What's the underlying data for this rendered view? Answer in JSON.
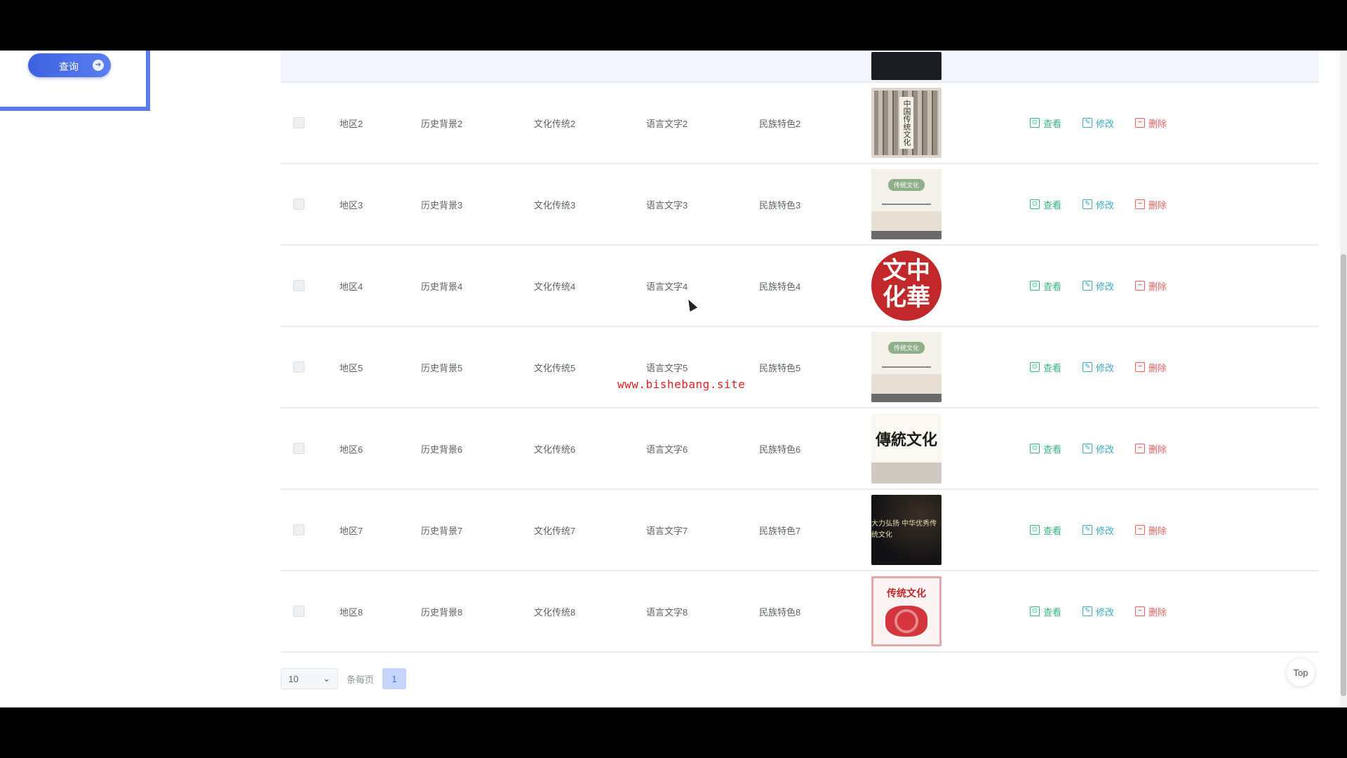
{
  "search": {
    "query_button_label": "查询",
    "query_button_dot": "●"
  },
  "table": {
    "rows": [
      {
        "region": "地区2",
        "history": "历史背景2",
        "culture": "文化传统2",
        "language": "语言文字2",
        "ethnic": "民族特色2",
        "image_text": "中国传统文化"
      },
      {
        "region": "地区3",
        "history": "历史背景3",
        "culture": "文化传统3",
        "language": "语言文字3",
        "ethnic": "民族特色3",
        "image_text": "传统文化"
      },
      {
        "region": "地区4",
        "history": "历史背景4",
        "culture": "文化传统4",
        "language": "语言文字4",
        "ethnic": "民族特色4",
        "image_text": "文中化華"
      },
      {
        "region": "地区5",
        "history": "历史背景5",
        "culture": "文化传统5",
        "language": "语言文字5",
        "ethnic": "民族特色5",
        "image_text": "传统文化"
      },
      {
        "region": "地区6",
        "history": "历史背景6",
        "culture": "文化传统6",
        "language": "语言文字6",
        "ethnic": "民族特色6",
        "image_text": "傳統文化"
      },
      {
        "region": "地区7",
        "history": "历史背景7",
        "culture": "文化传统7",
        "language": "语言文字7",
        "ethnic": "民族特色7",
        "image_text": "大力弘扬 中华优秀传统文化"
      },
      {
        "region": "地区8",
        "history": "历史背景8",
        "culture": "文化传统8",
        "language": "语言文字8",
        "ethnic": "民族特色8",
        "image_text": "传统文化"
      }
    ],
    "actions": {
      "view": "查看",
      "edit": "修改",
      "delete": "删除"
    }
  },
  "pagination": {
    "page_size": "10",
    "per_page_label": "条每页",
    "current_page": "1"
  },
  "watermark": "www.bishebang.site",
  "top_button": "Top",
  "colors": {
    "accent": "#4b6ee0",
    "view": "#35b57f",
    "edit": "#3ba9c5",
    "delete": "#f0625e",
    "watermark": "#e02020"
  }
}
